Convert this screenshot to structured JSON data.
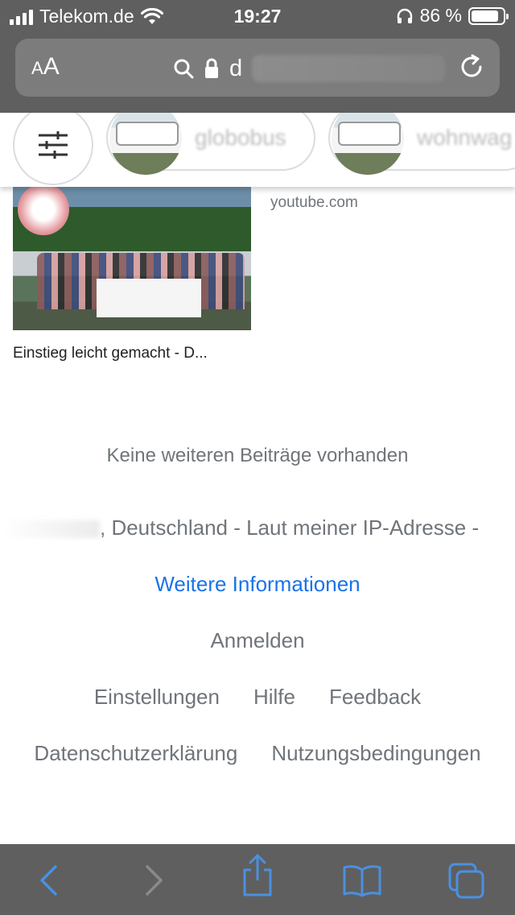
{
  "status_bar": {
    "carrier": "Telekom.de",
    "time": "19:27",
    "battery_text": "86 %",
    "battery_level": 0.86,
    "icons": [
      "signal-icon",
      "wifi-icon",
      "headphones-icon",
      "battery-icon"
    ]
  },
  "address_bar": {
    "text_size_small": "A",
    "text_size_large": "A",
    "url_visible": "d"
  },
  "chips": [
    {
      "label": "globobus"
    },
    {
      "label": "wohnwag"
    }
  ],
  "result": {
    "title": "Einstieg leicht gemacht - D...",
    "source": "youtube.com"
  },
  "footer": {
    "no_more": "Keine weiteren Beiträge vorhanden",
    "location_partial": ", Deutschland - Laut meiner IP-Adresse -",
    "more_info": "Weitere Informationen",
    "sign_in": "Anmelden",
    "settings": "Einstellungen",
    "help": "Hilfe",
    "feedback": "Feedback",
    "privacy": "Datenschutzerklärung",
    "terms": "Nutzungsbedingungen"
  },
  "colors": {
    "chrome_bg": "#5f5f5f",
    "toolbar_accent": "#4a90e2",
    "link_blue": "#1a73e8",
    "muted_text": "#70757a"
  }
}
